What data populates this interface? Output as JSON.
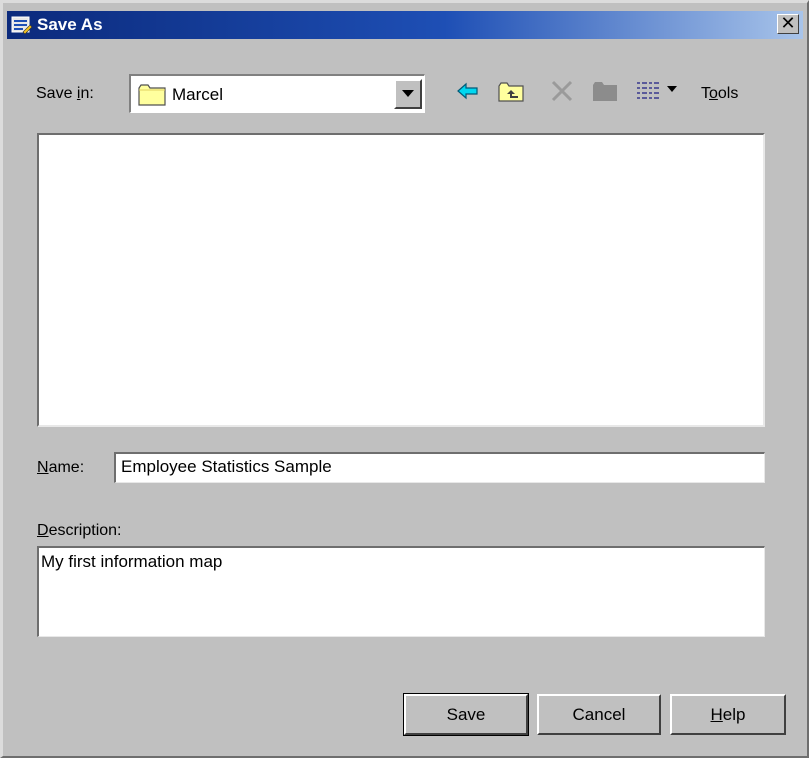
{
  "window": {
    "title": "Save As",
    "close_label": "✕"
  },
  "toolbar": {
    "save_in_prefix": "Save ",
    "save_in_mnemonic": "i",
    "save_in_suffix": "n:",
    "save_in_value": "Marcel",
    "tools_prefix": "T",
    "tools_mnemonic": "o",
    "tools_suffix": "ols",
    "icons": [
      "back-icon",
      "up-folder-icon",
      "delete-icon",
      "new-folder-icon",
      "view-menu-icon"
    ]
  },
  "fields": {
    "name_mnemonic": "N",
    "name_suffix": "ame:",
    "name_value": "Employee Statistics Sample",
    "description_mnemonic": "D",
    "description_suffix": "escription:",
    "description_value": "My first information map"
  },
  "buttons": {
    "save": "Save",
    "cancel": "Cancel",
    "help_mnemonic": "H",
    "help_suffix": "elp"
  },
  "colors": {
    "titlebar_start": "#0b2a7c",
    "titlebar_end": "#a8c4ea",
    "face": "#c0c0c0",
    "back_arrow": "#00d8f0",
    "folder": "#ffff9e"
  }
}
